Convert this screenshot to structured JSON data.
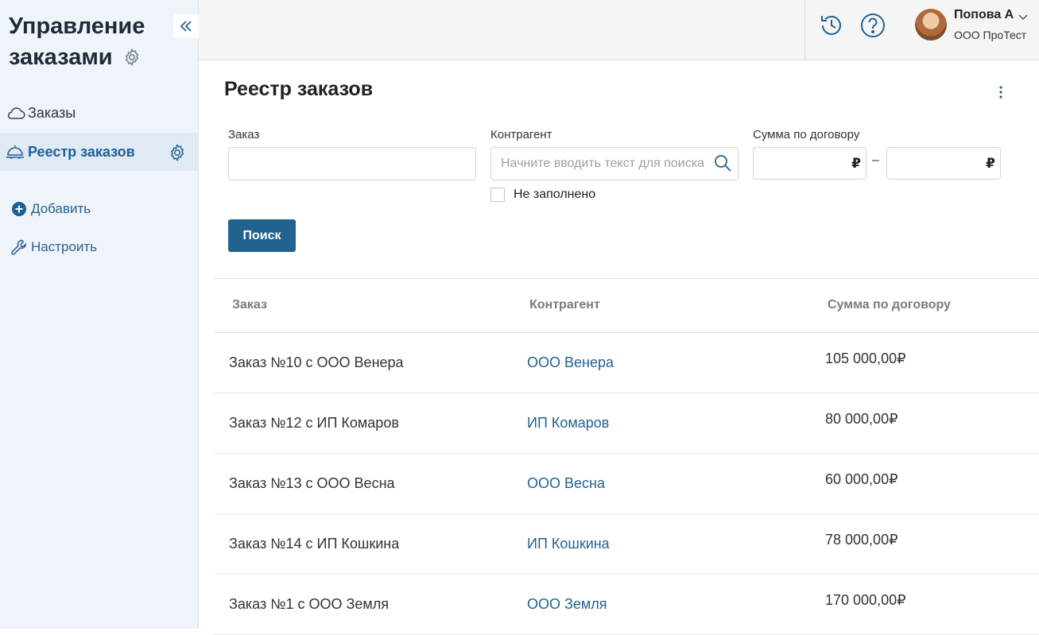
{
  "sidebar": {
    "app_title": "Управление заказами",
    "nav": [
      {
        "label": "Заказы",
        "icon": "cloud-icon"
      },
      {
        "label": "Реестр заказов",
        "icon": "bell-icon"
      }
    ],
    "actions": [
      {
        "label": "Добавить",
        "icon": "plus-circle-icon"
      },
      {
        "label": "Настроить",
        "icon": "wrench-icon"
      }
    ]
  },
  "header": {
    "user_name": "Попова А",
    "user_org": "ООО ПроТест"
  },
  "main": {
    "title": "Реестр заказов",
    "filters": {
      "order_label": "Заказ",
      "order_value": "",
      "contractor_label": "Контрагент",
      "contractor_placeholder": "Начните вводить текст для поиска",
      "empty_label": "Не заполнено",
      "sum_label": "Сумма по договору",
      "currency": "₽",
      "range_dash": "–",
      "search_button": "Поиск"
    },
    "table": {
      "columns": [
        "Заказ",
        "Контрагент",
        "Сумма по договору"
      ],
      "rows": [
        {
          "order": "Заказ №10 с ООО Венера",
          "contractor": "ООО Венера",
          "sum": "105 000,00₽"
        },
        {
          "order": "Заказ №12 с ИП Комаров",
          "contractor": "ИП Комаров",
          "sum": "80 000,00₽"
        },
        {
          "order": "Заказ №13 с ООО Весна",
          "contractor": "ООО Весна",
          "sum": "60 000,00₽"
        },
        {
          "order": "Заказ №14 с ИП Кошкина",
          "contractor": "ИП Кошкина",
          "sum": "78 000,00₽"
        },
        {
          "order": "Заказ №1 с ООО Земля",
          "contractor": "ООО Земля",
          "sum": "170 000,00₽"
        }
      ]
    }
  },
  "colors": {
    "accent": "#22628f",
    "sidebar_bg": "#eef4fa",
    "sidebar_active_bg": "#dfeaf5"
  }
}
